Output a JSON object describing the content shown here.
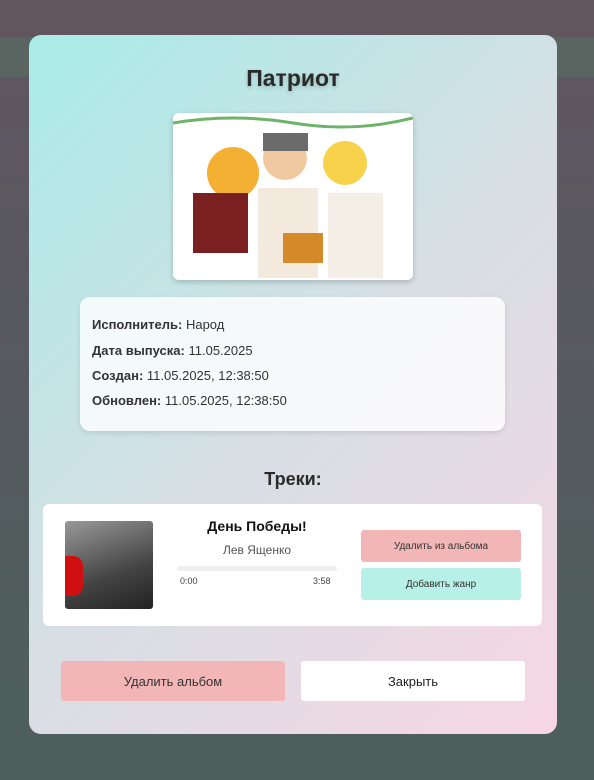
{
  "album": {
    "title": "Патриот",
    "info": [
      {
        "label": "Исполнитель:",
        "value": "Народ"
      },
      {
        "label": "Дата выпуска:",
        "value": "11.05.2025"
      },
      {
        "label": "Создан:",
        "value": "11.05.2025, 12:38:50"
      },
      {
        "label": "Обновлен:",
        "value": "11.05.2025, 12:38:50"
      }
    ]
  },
  "tracks_heading": "Треки:",
  "tracks": [
    {
      "title": "День Победы!",
      "artist": "Лев Ященко",
      "current_time": "0:00",
      "duration": "3:58",
      "progress": 0,
      "remove_label": "Удалить из альбома",
      "add_genre_label": "Добавить жанр"
    }
  ],
  "footer": {
    "delete_label": "Удалить альбом",
    "close_label": "Закрыть"
  }
}
